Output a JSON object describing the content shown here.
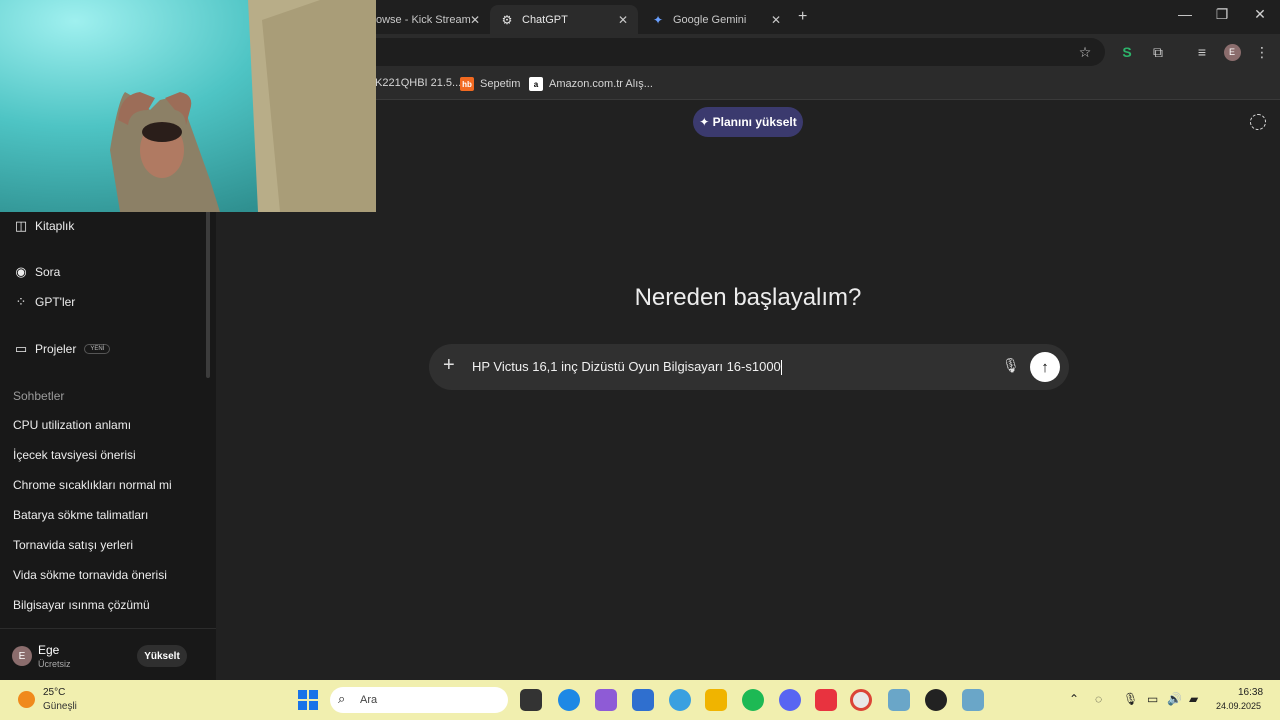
{
  "browser": {
    "tabs": [
      {
        "title": "owse - Kick Stream",
        "active": false
      },
      {
        "title": "ChatGPT",
        "active": true
      },
      {
        "title": "Google Gemini",
        "active": false
      }
    ],
    "bookmarks": [
      {
        "label": "K221QHBI 21.5..."
      },
      {
        "label": "Sepetim",
        "favicon_text": "hb"
      },
      {
        "label": "Amazon.com.tr Alış...",
        "favicon_text": "a"
      }
    ],
    "profile_initial": "E"
  },
  "sidebar": {
    "top_items": [
      {
        "label": "Kitaplık",
        "icon": "library-icon"
      },
      {
        "label": "Sora",
        "icon": "play-circle-icon"
      },
      {
        "label": "GPT'ler",
        "icon": "grid-icon"
      },
      {
        "label": "Projeler",
        "icon": "folder-icon",
        "badge": "YENİ"
      }
    ],
    "section_title": "Sohbetler",
    "chats": [
      "CPU utilization anlamı",
      "İçecek tavsiyesi önerisi",
      "Chrome sıcaklıkları normal mi",
      "Batarya sökme talimatları",
      "Tornavida satışı yerleri",
      "Vida sökme tornavida önerisi",
      "Bilgisayar ısınma çözümü"
    ],
    "user": {
      "initial": "E",
      "name": "Ege",
      "plan": "Ücretsiz",
      "upgrade_label": "Yükselt"
    }
  },
  "main": {
    "upgrade_pill": "✦ Planını yükselt",
    "heading": "Nereden başlayalım?",
    "composer_text": "HP Victus 16,1 inç Dizüstü Oyun Bilgisayarı 16-s1000"
  },
  "taskbar": {
    "temperature": "25°C",
    "condition": "Güneşli",
    "search_placeholder": "Ara",
    "time": "16:38",
    "date": "24.09.2025"
  },
  "colors": {
    "sidebar_bg": "#181818",
    "main_bg": "#212121",
    "composer_bg": "#303030",
    "upgrade_pill_bg": "#3b3a6e",
    "taskbar_bg": "#f1efaf"
  }
}
